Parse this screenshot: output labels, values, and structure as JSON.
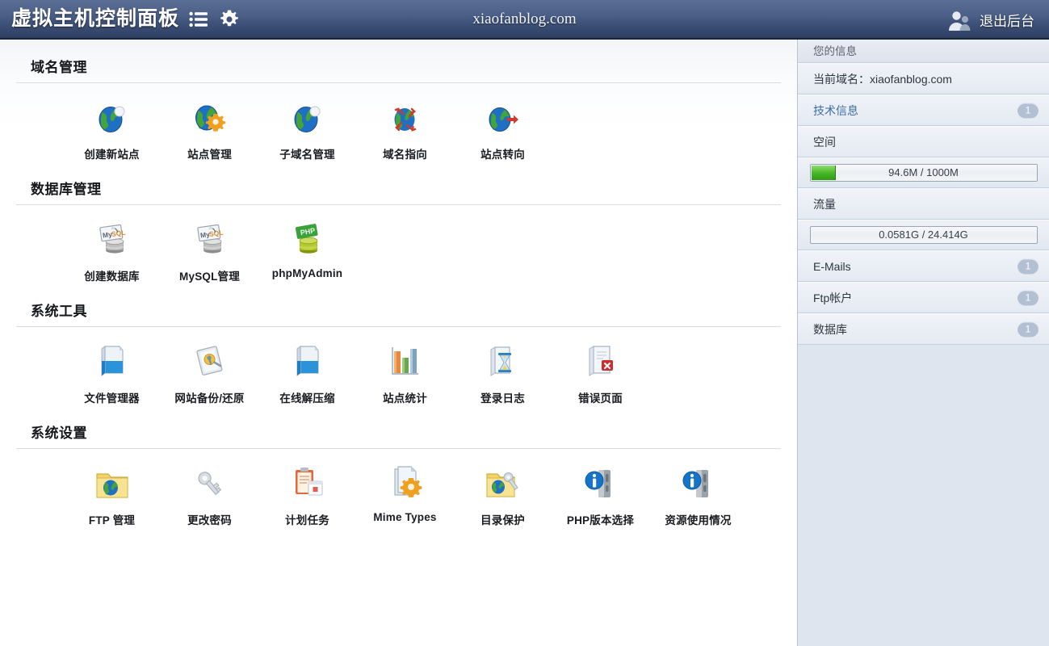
{
  "header": {
    "brand": "虚拟主机控制面板",
    "list_icon": "list-icon",
    "gear_icon": "gear-icon",
    "site_title": "xiaofanblog.com",
    "user_icon": "user-icon",
    "logout_label": "退出后台",
    "bg_color": "#3f5279"
  },
  "sections": [
    {
      "title": "域名管理",
      "tiles": [
        {
          "caption": "创建新站点",
          "icon": "globe-new-icon"
        },
        {
          "caption": "站点管理",
          "icon": "globe-gear-icon"
        },
        {
          "caption": "子域名管理",
          "icon": "globe-sub-icon"
        },
        {
          "caption": "域名指向",
          "icon": "globe-pin-icon"
        },
        {
          "caption": "站点转向",
          "icon": "globe-arrow-icon"
        }
      ]
    },
    {
      "title": "数据库管理",
      "tiles": [
        {
          "caption": "创建数据库",
          "icon": "mysql-new-icon"
        },
        {
          "caption": "MySQL管理",
          "icon": "mysql-manage-icon"
        },
        {
          "caption": "phpMyAdmin",
          "icon": "phpmyadmin-icon"
        }
      ]
    },
    {
      "title": "系统工具",
      "tiles": [
        {
          "caption": "文件管理器",
          "icon": "file-manager-icon"
        },
        {
          "caption": "网站备份/还原",
          "icon": "backup-disk-icon"
        },
        {
          "caption": "在线解压缩",
          "icon": "unzip-icon"
        },
        {
          "caption": "站点统计",
          "icon": "bar-chart-icon"
        },
        {
          "caption": "登录日志",
          "icon": "hourglass-log-icon"
        },
        {
          "caption": "错误页面",
          "icon": "error-page-icon"
        }
      ]
    },
    {
      "title": "系统设置",
      "tiles": [
        {
          "caption": "FTP 管理",
          "icon": "ftp-folder-icon"
        },
        {
          "caption": "更改密码",
          "icon": "key-icon"
        },
        {
          "caption": "计划任务",
          "icon": "clipboard-calendar-icon"
        },
        {
          "caption": "Mime Types",
          "icon": "mime-gear-icon"
        },
        {
          "caption": "目录保护",
          "icon": "folder-protect-icon"
        },
        {
          "caption": "PHP版本选择",
          "icon": "info-server-icon"
        },
        {
          "caption": "资源使用情况",
          "icon": "info-server-icon"
        }
      ]
    }
  ],
  "sidebar": {
    "heading": "您的信息",
    "domain_row": "当前域名：xiaofanblog.com",
    "tech_info": {
      "label": "技术信息",
      "badge": "1"
    },
    "space": {
      "label": "空间",
      "meter_text": "94.6M / 1000M",
      "fill_percent": 11,
      "fill_color": "#4cb82a"
    },
    "traffic": {
      "label": "流量",
      "meter_text": "0.0581G / 24.414G",
      "fill_percent": 0
    },
    "rows": [
      {
        "label": "E-Mails",
        "badge": "1"
      },
      {
        "label": "Ftp帐户",
        "badge": "1"
      },
      {
        "label": "数据库",
        "badge": "1"
      }
    ]
  }
}
